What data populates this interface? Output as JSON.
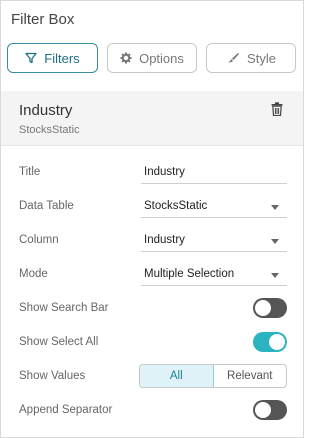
{
  "panel": {
    "title": "Filter Box"
  },
  "tabs": [
    {
      "label": "Filters",
      "icon": "filter-icon",
      "active": true
    },
    {
      "label": "Options",
      "icon": "gear-icon",
      "active": false
    },
    {
      "label": "Style",
      "icon": "brush-icon",
      "active": false
    }
  ],
  "filter": {
    "title": "Industry",
    "source": "StocksStatic",
    "delete_icon": "trash-icon"
  },
  "settings": {
    "title": {
      "label": "Title",
      "value": "Industry"
    },
    "data_table": {
      "label": "Data Table",
      "value": "StocksStatic"
    },
    "column": {
      "label": "Column",
      "value": "Industry"
    },
    "mode": {
      "label": "Mode",
      "value": "Multiple Selection"
    },
    "show_search_bar": {
      "label": "Show Search Bar",
      "on": false
    },
    "show_select_all": {
      "label": "Show Select All",
      "on": true
    },
    "show_values": {
      "label": "Show Values",
      "options": [
        "All",
        "Relevant"
      ],
      "selected": "All"
    },
    "append_separator": {
      "label": "Append Separator",
      "on": false
    }
  },
  "colors": {
    "accent": "#2bb3c0",
    "active_border": "#3a8aa3",
    "toggle_off": "#555555"
  }
}
